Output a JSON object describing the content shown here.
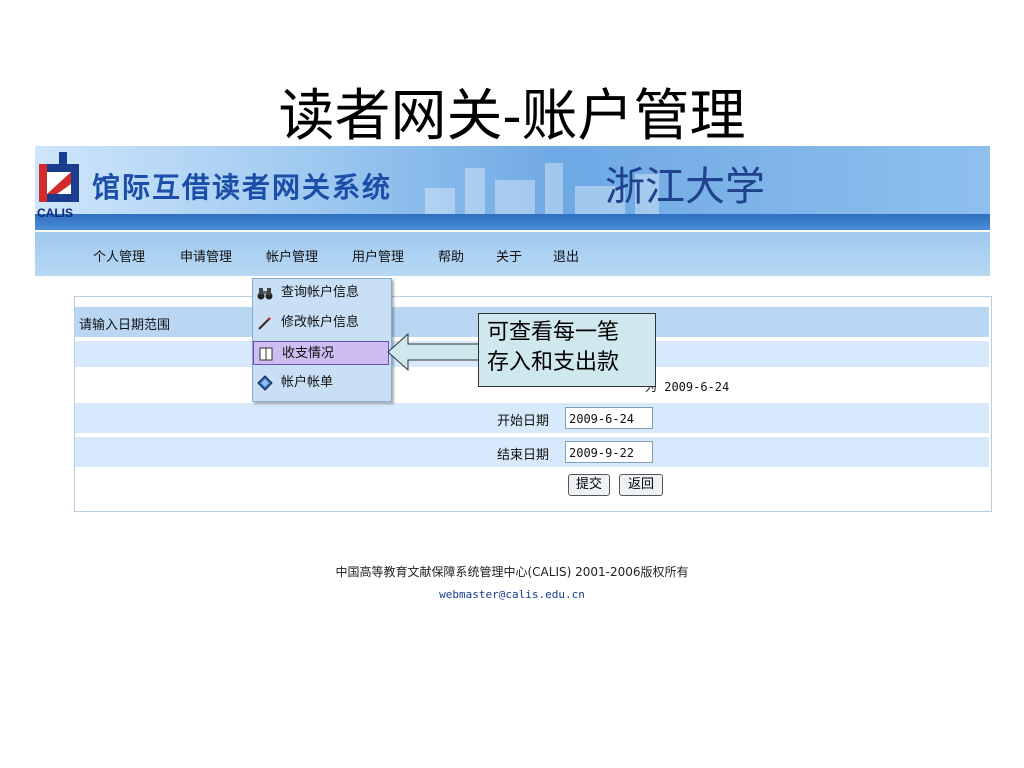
{
  "slide": {
    "title": "读者网关-账户管理"
  },
  "header": {
    "logo_text": "CALIS",
    "system_name": "馆际互借读者网关系统",
    "university": "浙江大学"
  },
  "nav": {
    "items": [
      "个人管理",
      "申请管理",
      "帐户管理",
      "用户管理",
      "帮助",
      "关于",
      "退出"
    ]
  },
  "dropdown": {
    "items": [
      {
        "label": "查询帐户信息",
        "icon": "binoculars-icon"
      },
      {
        "label": "修改帐户信息",
        "icon": "pen-icon"
      },
      {
        "label": "收支情况",
        "icon": "book-icon",
        "active": true
      },
      {
        "label": "帐户帐单",
        "icon": "diamond-icon"
      }
    ]
  },
  "form": {
    "header_label": "请输入日期范围",
    "range_note": "为 2009-6-24",
    "start_label": "开始日期",
    "start_value": "2009-6-24",
    "end_label": "结束日期",
    "end_value": "2009-9-22",
    "submit_label": "提交",
    "back_label": "返回"
  },
  "callout": {
    "line1": "可查看每一笔",
    "line2": "存入和支出款"
  },
  "footer": {
    "copyright": "中国高等教育文献保障系统管理中心(CALIS) 2001-2006版权所有",
    "email": "webmaster@calis.edu.cn"
  },
  "colors": {
    "banner": "#6ea9e4",
    "nav": "#b8d8f4",
    "row_blue": "#d7e9fb",
    "active_item": "#cdbdf1",
    "callout": "#cfe8ee"
  }
}
